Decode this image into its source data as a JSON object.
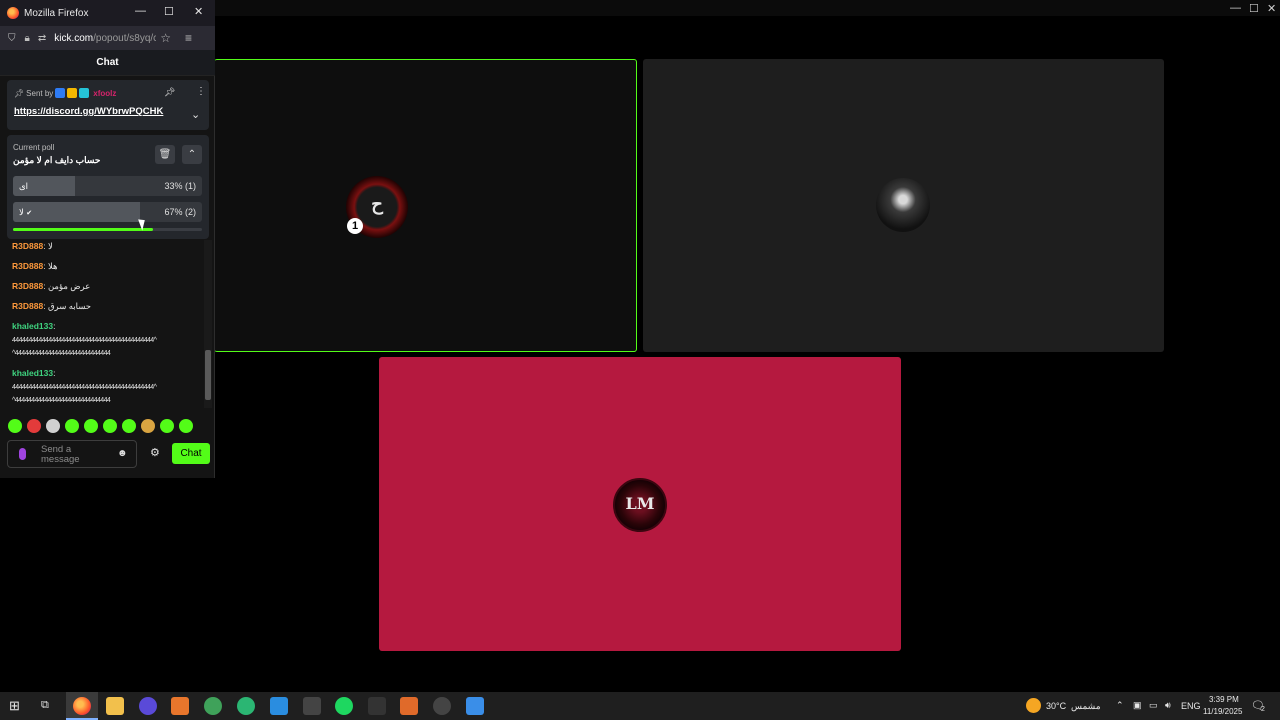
{
  "browser": {
    "window_title": "Mozilla Firefox",
    "url_host": "kick.com",
    "url_path": "/popout/s8yq/ch"
  },
  "chat": {
    "header": "Chat",
    "pinned": {
      "sent_by_label": "Sent by",
      "username": "xfoolz",
      "link": "https://discord.gg/WYbrwPQCHK"
    },
    "poll": {
      "label": "Current poll",
      "question": "حساب دايف ام لا مؤمن",
      "options": [
        {
          "label": "اى",
          "percent_text": "33% (1)",
          "fraction": 0.33
        },
        {
          "label": "لا",
          "percent_text": "67% (2)",
          "fraction": 0.67
        }
      ],
      "time_remaining_fraction": 0.74
    },
    "messages": [
      {
        "user": "R3D888",
        "sep": ":",
        "text": "لا",
        "color": "#ff9a3c"
      },
      {
        "user": "R3D888",
        "sep": ":",
        "text": "هلا",
        "color": "#ff9a3c"
      },
      {
        "user": "R3D888",
        "sep": ":",
        "text": "عرض مؤمن",
        "color": "#ff9a3c"
      },
      {
        "user": "R3D888",
        "sep": ":",
        "text": "حسابه سرق",
        "color": "#ff9a3c"
      },
      {
        "user": "khaled133",
        "sep": ":",
        "line1": "4444444444444444444444444444444444444444444^",
        "line2": "^44444444444444444444444444444",
        "color": "#3fd37f"
      },
      {
        "user": "khaled133",
        "sep": ":",
        "line1": "4444444444444444444444444444444444444444444^",
        "line2": "^44444444444444444444444444444",
        "color": "#3fd37f"
      }
    ],
    "input_placeholder": "Send a message",
    "send_label": "Chat",
    "emote_colors": [
      "#53fc18",
      "#e33b3b",
      "#d0d0d0",
      "#53fc18",
      "#53fc18",
      "#53fc18",
      "#53fc18",
      "#d9a441",
      "#53fc18",
      "#53fc18"
    ]
  },
  "stage": {
    "tile_a_badge": "1",
    "accent": "#53fc18",
    "tile_c_color": "#b5193f"
  },
  "taskbar": {
    "weather_temp": "30°C",
    "weather_desc": "مشمس",
    "language": "ENG",
    "time": "3:39 PM",
    "date": "11/19/2025",
    "notifications": "2"
  }
}
